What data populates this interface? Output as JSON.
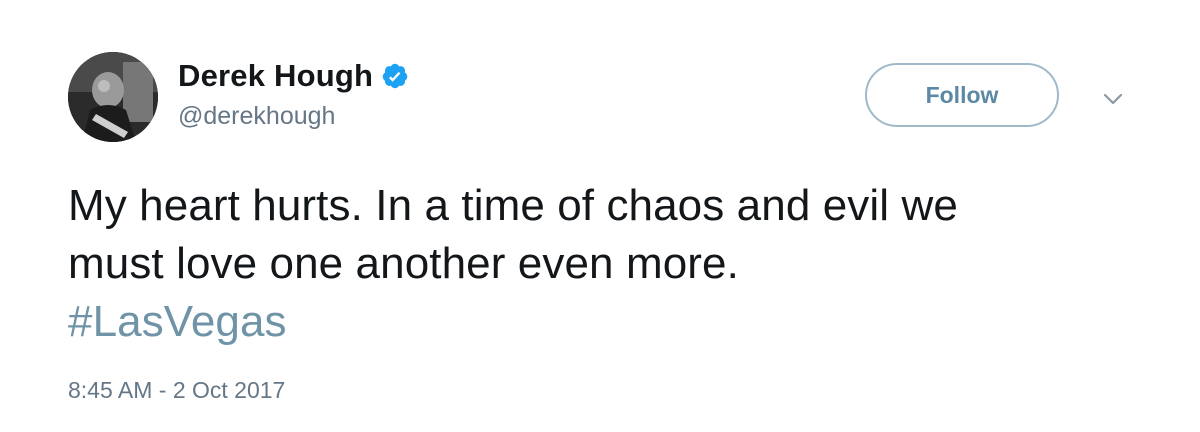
{
  "user": {
    "display_name": "Derek Hough",
    "handle": "@derekhough",
    "verified": true
  },
  "actions": {
    "follow_label": "Follow"
  },
  "tweet": {
    "line1": "My heart hurts. In a time of chaos and evil we",
    "line2": "must love one another even more.",
    "hashtag": "#LasVegas",
    "timestamp": "8:45 AM - 2 Oct 2017"
  },
  "colors": {
    "verified_blue": "#1da1f2",
    "hashtag": "#6f93a7",
    "follow_border": "#9fb9c9",
    "follow_text": "#5d89a5",
    "muted_text": "#657786"
  },
  "icons": {
    "verified": "verified-badge-icon",
    "more": "chevron-down-icon"
  }
}
